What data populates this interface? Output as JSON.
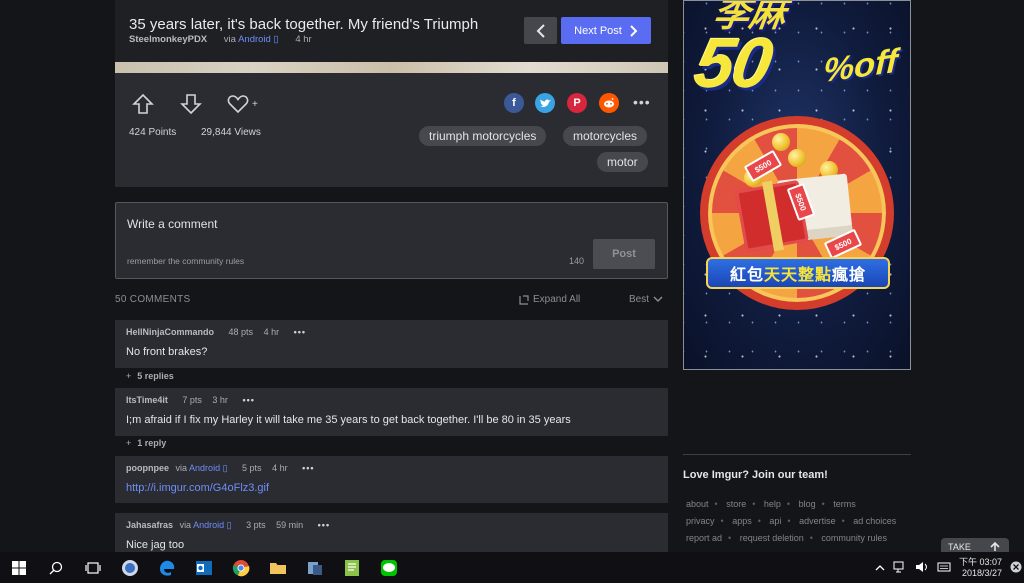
{
  "post": {
    "title": "35 years later, it's back together. My friend's Triumph",
    "author": "SteelmonkeyPDX",
    "via_prefix": "via",
    "via_platform": "Android",
    "time": "4 hr",
    "next_label": "Next Post"
  },
  "stats": {
    "points": "424 Points",
    "views": "29,844 Views",
    "favorite_plus": "+"
  },
  "tags": [
    "triumph motorcycles",
    "motorcycles",
    "motor"
  ],
  "share_icons": [
    "facebook-icon",
    "twitter-icon",
    "pinterest-icon",
    "reddit-icon"
  ],
  "comment_box": {
    "prompt": "Write a comment",
    "rules": "remember the community rules",
    "char_count": "140",
    "post_label": "Post"
  },
  "comments_bar": {
    "count": "50 COMMENTS",
    "expand": "Expand All",
    "sort": "Best"
  },
  "comments": [
    {
      "author": "HellNinjaCommando",
      "via": "",
      "via_platform": "",
      "pts": "48 pts",
      "time": "4 hr",
      "text": "No front brakes?",
      "is_link": false,
      "replies": "5 replies"
    },
    {
      "author": "ItsTime4it",
      "via": "",
      "via_platform": "",
      "pts": "7 pts",
      "time": "3 hr",
      "text": "I;m afraid if I fix my Harley it will take me 35 years to get back together. I'll be 80 in 35 years",
      "is_link": false,
      "replies": "1 reply"
    },
    {
      "author": "poopnpee",
      "via": "via",
      "via_platform": "Android",
      "pts": "5 pts",
      "time": "4 hr",
      "text": "http://i.imgur.com/G4oFlz3.gif",
      "is_link": true,
      "replies": ""
    },
    {
      "author": "Jahasafras",
      "via": "via",
      "via_platform": "Android",
      "pts": "3 pts",
      "time": "59 min",
      "text": "Nice jag too",
      "is_link": false,
      "replies": ""
    }
  ],
  "ad": {
    "top_text": "李麻",
    "discount": "50",
    "percent_off": "%off",
    "banner_pre": "紅包",
    "banner_highlight": "天天整點",
    "banner_post": "瘋搶",
    "bills": [
      "$500",
      "$500",
      "$500"
    ]
  },
  "sidebar": {
    "love": "Love Imgur? Join our team!",
    "footer_links": [
      "about",
      "store",
      "help",
      "blog",
      "terms",
      "privacy",
      "apps",
      "api",
      "advertise",
      "ad choices",
      "report ad",
      "request deletion",
      "community rules"
    ]
  },
  "take_button": "TAKE",
  "taskbar": {
    "time_period": "下午 03:07",
    "date": "2018/3/27",
    "apps": [
      "file-explorer-icon",
      "edge-icon",
      "outlook-icon",
      "chrome-icon",
      "folder-icon",
      "app-icon",
      "notepad-icon",
      "line-icon"
    ]
  }
}
